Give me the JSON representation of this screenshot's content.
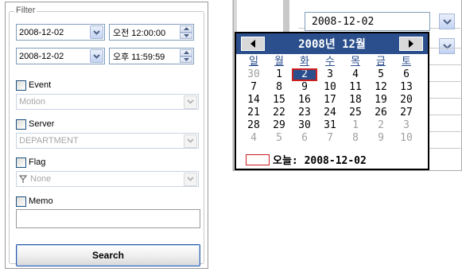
{
  "filter": {
    "title": "Filter",
    "start": {
      "date": "2008-12-02",
      "time": "오전 12:00:00"
    },
    "end": {
      "date": "2008-12-02",
      "time": "오후 11:59:59"
    },
    "event": {
      "label": "Event",
      "value": "Motion"
    },
    "server": {
      "label": "Server",
      "value": "DEPARTMENT"
    },
    "flag": {
      "label": "Flag",
      "value": "None"
    },
    "memo": {
      "label": "Memo",
      "value": ""
    },
    "search_label": "Search"
  },
  "picker": {
    "value": "2008-12-02",
    "month_title": "2008년 12월",
    "weekdays": [
      "일",
      "월",
      "화",
      "수",
      "목",
      "금",
      "토"
    ],
    "weeks": [
      [
        "30",
        "1",
        "2",
        "3",
        "4",
        "5",
        "6"
      ],
      [
        "7",
        "8",
        "9",
        "10",
        "11",
        "12",
        "13"
      ],
      [
        "14",
        "15",
        "16",
        "17",
        "18",
        "19",
        "20"
      ],
      [
        "21",
        "22",
        "23",
        "24",
        "25",
        "26",
        "27"
      ],
      [
        "28",
        "29",
        "30",
        "31",
        "1",
        "2",
        "3"
      ],
      [
        "4",
        "5",
        "6",
        "7",
        "8",
        "9",
        "10"
      ]
    ],
    "today_label": "오늘: 2008-12-02",
    "colors": {
      "header": "#2b4f8c",
      "selected_border": "#cc1f1f"
    }
  }
}
